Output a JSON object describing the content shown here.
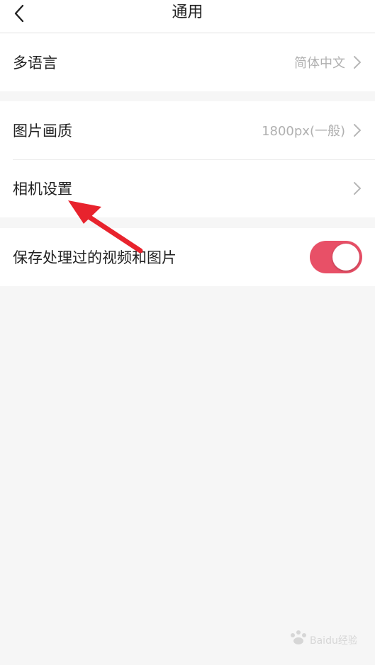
{
  "header": {
    "title": "通用"
  },
  "groups": [
    {
      "items": [
        {
          "label": "多语言",
          "value": "简体中文"
        }
      ]
    },
    {
      "items": [
        {
          "label": "图片画质",
          "value": "1800px(一般)"
        },
        {
          "label": "相机设置",
          "value": ""
        }
      ]
    },
    {
      "items": [
        {
          "label": "保存处理过的视频和图片",
          "toggle": true
        }
      ]
    }
  ],
  "colors": {
    "accent": "#e85067",
    "background": "#f6f6f6",
    "annotation_arrow": "#e8232d"
  },
  "icons": {
    "back": "chevron-left-icon",
    "disclosure": "chevron-right-icon"
  },
  "watermark": {
    "text": "Baidu经验"
  }
}
